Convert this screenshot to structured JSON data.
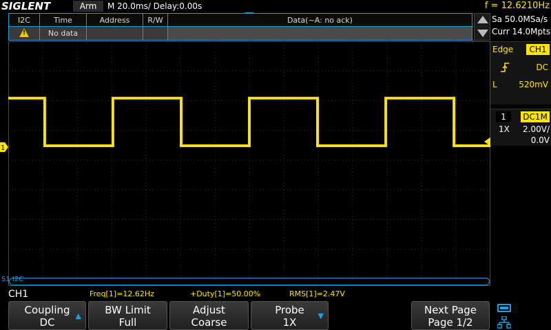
{
  "topbar": {
    "logo": "SIGLENT",
    "run_state": "Arm",
    "timebase": "M 20.0ms/ Delay:0.00s",
    "frequency": "f = 12.6210Hz"
  },
  "decode_table": {
    "headers": [
      "I2C",
      "Time",
      "Address",
      "R/W",
      "Data(~A: no ack)"
    ],
    "row": {
      "icon": "warning-icon",
      "time": "No data",
      "address": "",
      "rw": "",
      "data": ""
    }
  },
  "right_panel": {
    "sample_rate": "Sa 50.0MSa/s",
    "memory_depth": "Curr 14.0Mpts",
    "trigger": {
      "type": "Edge",
      "source": "CH1",
      "slope_icon": "rising-edge-icon",
      "coupling": "DC",
      "level_label": "L",
      "level": "520mV"
    },
    "channel": {
      "number": "1",
      "coupling": "DC1M",
      "probe": "1X",
      "scale": "2.00V/",
      "offset": "0.0V"
    }
  },
  "grid": {
    "marker_label": "1",
    "bus_label": "S1 I2C",
    "colors": {
      "trace": "#ffe600",
      "grid": "#3a3a3a",
      "accent": "#1ea0e6"
    }
  },
  "waveform": {
    "type": "square",
    "frequency_hz": 12.621,
    "duty_percent": 50,
    "high_v": 3.2,
    "low_v": 0.0
  },
  "measurements": {
    "channel": "CH1",
    "freq": "Freq[1]=12.62Hz",
    "duty": "+Duty[1]=50.00%",
    "rms": "RMS[1]=2.47V"
  },
  "softkeys": {
    "coupling": {
      "line1": "Coupling",
      "line2": "DC"
    },
    "bw_limit": {
      "line1": "BW Limit",
      "line2": "Full"
    },
    "adjust": {
      "line1": "Adjust",
      "line2": "Coarse"
    },
    "probe": {
      "line1": "Probe",
      "line2": "1X"
    },
    "next_page": {
      "line1": "Next Page",
      "line2": "Page 1/2"
    }
  }
}
